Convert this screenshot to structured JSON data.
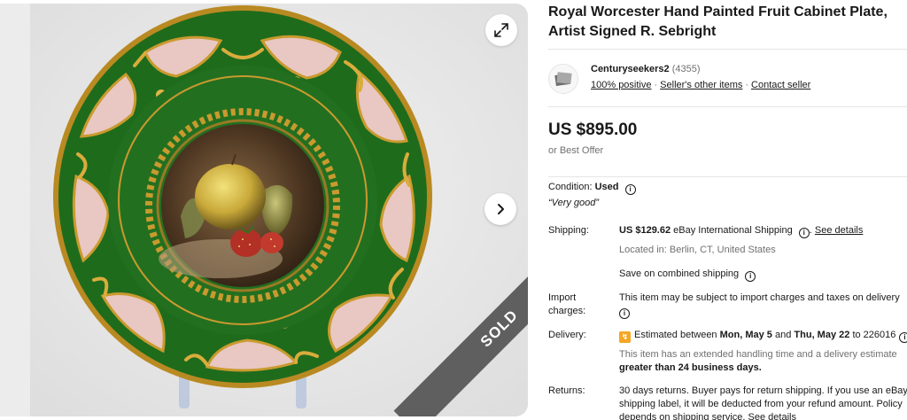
{
  "listing": {
    "title": "Royal Worcester Hand Painted Fruit Cabinet Plate, Artist Signed R. Sebright",
    "sold_label": "SOLD"
  },
  "seller": {
    "name": "Centuryseekers2",
    "feedback_count": "(4355)",
    "positive": "100% positive",
    "other_items": "Seller's other items",
    "contact": "Contact seller"
  },
  "pricing": {
    "price": "US $895.00",
    "best_offer": "or Best Offer"
  },
  "details": {
    "condition_label": "Condition:",
    "condition_value": "Used",
    "condition_note": "“Very good”",
    "shipping_label": "Shipping:",
    "shipping_price": "US $129.62",
    "shipping_service": "eBay International Shipping",
    "see_details": "See details",
    "located_in": "Located in: Berlin, CT, United States",
    "combined_shipping": "Save on combined shipping",
    "import_label": "Import charges:",
    "import_text": "This item may be subject to import charges and taxes on delivery",
    "delivery_label": "Delivery:",
    "delivery_prefix": "Estimated between",
    "delivery_start": "Mon, May 5",
    "delivery_and": "and",
    "delivery_end": "Thu, May 22",
    "delivery_to": "to 226016",
    "handling_text": "This item has an extended handling time and a delivery estimate",
    "handling_bold": "greater than 24 business days.",
    "returns_label": "Returns:",
    "returns_line1": "30 days returns. Buyer pays for return shipping. If you use an eBay",
    "returns_line2": "shipping label, it will be deducted from your refund amount. Policy",
    "returns_line3": "depends on shipping service.",
    "returns_see_details": "See details"
  },
  "icons": {
    "expand": "expand-icon",
    "next": "chevron-right-icon",
    "info": "info-icon",
    "delivery_badge": "fast-delivery-icon"
  },
  "colors": {
    "plate_green": "#1f6b1c",
    "plate_pink": "#e9c7c2",
    "gold": "#c99a2e",
    "sold_banner": "#5f5f5f"
  }
}
